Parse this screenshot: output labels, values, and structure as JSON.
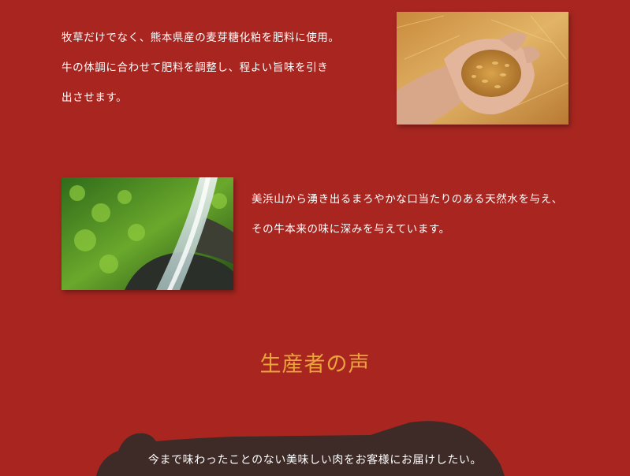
{
  "feed_section": {
    "lines": [
      "牧草だけでなく、熊本県産の麦芽糖化粕を肥料に使用。",
      "牛の体調に合わせて肥料を調整し、程よい旨味を引き",
      "出させます。"
    ],
    "image_icon": "hand-holding-grain-photo"
  },
  "water_section": {
    "lines": [
      "美浜山から湧き出るまろやかな口当たりのある天然水を与え、",
      "その牛本来の味に深みを与えています。"
    ],
    "image_icon": "spring-water-photo"
  },
  "voice_section": {
    "heading": "生産者の声",
    "quote": "今まで味わったことのない美味しい肉をお客様にお届けしたい。"
  },
  "colors": {
    "background": "#a92620",
    "heading": "#e8a33b",
    "text": "#ffffff",
    "cow_silhouette": "#3e2a26"
  }
}
